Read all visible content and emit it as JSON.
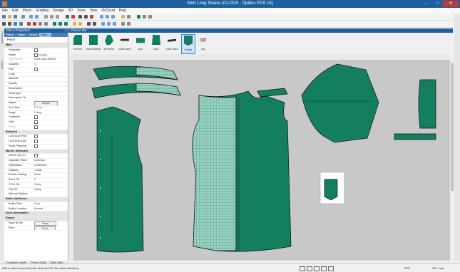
{
  "window": {
    "title": "Shirt Long Sleeve (01-PDS - Optitex PDS 15)"
  },
  "menu": [
    "File",
    "Edit",
    "Piece",
    "Grading",
    "Design",
    "3D",
    "Tools",
    "View",
    "O/Cloud",
    "Help"
  ],
  "panel": {
    "title": "Piece Properties",
    "tabs": [
      "Piece",
      "Seam",
      "Notch",
      "Plac..."
    ],
    "selector": "Piece",
    "rows": [
      {
        "type": "section",
        "name": "Main"
      },
      {
        "name": "Protected",
        "check": true
      },
      {
        "name": "Name",
        "value": "Pocket",
        "check": true
      },
      {
        "name": "Style Name",
        "value": "Shirt Long Sleeve",
        "dim": true
      },
      {
        "name": "Quantity",
        "value": "1"
      },
      {
        "name": "Pair",
        "check": true
      },
      {
        "name": "Code"
      },
      {
        "name": "Material"
      },
      {
        "name": "Quality"
      },
      {
        "name": "Description"
      },
      {
        "name": "Text/Layer"
      },
      {
        "name": "Description Te"
      },
      {
        "name": "Adjust",
        "button": "Adjust"
      },
      {
        "name": "Font Size",
        "value": "0.7 cm"
      },
      {
        "name": "Angle",
        "value": "0 deg"
      },
      {
        "name": "Centered",
        "check": true
      },
      {
        "name": "Half",
        "check": true
      },
      {
        "name": "Mirror",
        "check": true,
        "dim": true
      },
      {
        "type": "section",
        "name": "Behavior"
      },
      {
        "name": "Lock Auto Posi",
        "check": true
      },
      {
        "name": "Lock Auto Upd",
        "check": true
      },
      {
        "name": "Fixed Placeme",
        "check": true
      },
      {
        "type": "section",
        "name": "Marker Attributes"
      },
      {
        "name": "Not for use in I",
        "check": true
      },
      {
        "name": "Opposite Piece",
        "value": "Up/Down"
      },
      {
        "name": "Orientation",
        "value": "Undefined"
      },
      {
        "name": "Rotation",
        "value": "1-Way"
      },
      {
        "name": "Enable Folding",
        "value": "None"
      },
      {
        "name": "Piece Tilt",
        "value": "0"
      },
      {
        "name": "CCW Tilt",
        "value": "0 deg"
      },
      {
        "name": "CW Tilt",
        "value": "0 deg"
      },
      {
        "name": "Manual Options"
      },
      {
        "type": "section",
        "name": "Buffer Attributes"
      },
      {
        "name": "Buffer Size",
        "value": "0 cm"
      },
      {
        "name": "Buffer Location",
        "value": "Around"
      },
      {
        "type": "section",
        "name": "Sizes Information"
      },
      {
        "type": "section",
        "name": "Report"
      },
      {
        "name": "Save to File",
        "button": "Save"
      },
      {
        "name": "Print",
        "button": "Print"
      }
    ],
    "bottom_tabs": [
      "Compare Length",
      "Pieces Table",
      "Style Sets"
    ]
  },
  "piece_bar": {
    "title": "Pieces Bar",
    "pieces": [
      {
        "label": "front left"
      },
      {
        "label": "back interlinier"
      },
      {
        "label": "left sleeve"
      },
      {
        "label": "collar stand"
      },
      {
        "label": "yoke"
      },
      {
        "label": "back"
      },
      {
        "label": "collar fused"
      },
      {
        "label": "Pocket",
        "selected": true
      },
      {
        "label": "flap"
      }
    ]
  },
  "status": {
    "message": "Add a notch to a point (Use Shift and Ctrl for notch direction)",
    "unit": "SEW",
    "units": "CM - sqm"
  },
  "colors": {
    "piece_fill": "#147e60",
    "canvas": "#c8c8c8",
    "accent": "#1f5f9e"
  }
}
